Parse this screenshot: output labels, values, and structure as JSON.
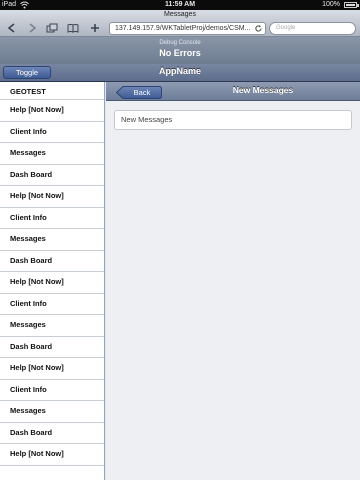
{
  "status_bar": {
    "carrier": "iPad",
    "time": "11:59 AM",
    "battery": "100%"
  },
  "browser": {
    "page_title": "Messages",
    "url": "137.149.157.9/WKTabletProj/demos/CSM...",
    "search_placeholder": "Google"
  },
  "debug_console": {
    "title": "Debug Console",
    "status": "No Errors"
  },
  "app_header": {
    "toggle_label": "Toggle",
    "title": "AppName"
  },
  "sidebar": {
    "items": [
      "GEOTEST",
      "Help [Not Now]",
      "Client Info",
      "Messages",
      "Dash Board",
      "Help [Not Now]",
      "Client Info",
      "Messages",
      "Dash Board",
      "Help [Not Now]",
      "Client Info",
      "Messages",
      "Dash Board",
      "Help [Not Now]",
      "Client Info",
      "Messages",
      "Dash Board",
      "Help [Not Now]"
    ]
  },
  "detail": {
    "back_label": "Back",
    "title": "New Messages",
    "card_text": "New Messages"
  },
  "icons": {
    "wifi": "wifi-icon",
    "battery": "battery-icon",
    "back": "back-arrow-icon",
    "forward": "forward-arrow-icon",
    "tabs": "pages-icon",
    "bookmarks": "bookmarks-icon",
    "add": "add-bookmark-icon",
    "reload": "reload-icon"
  }
}
